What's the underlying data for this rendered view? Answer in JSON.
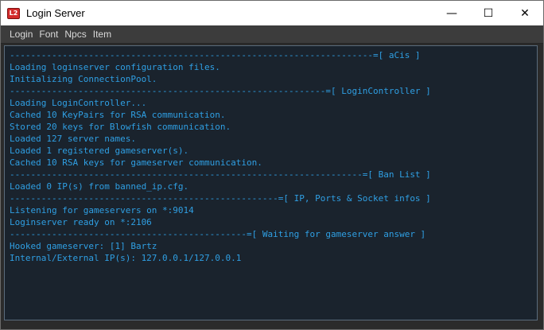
{
  "window": {
    "title": "Login Server",
    "icon_label": "L2",
    "controls": {
      "minimize": "—",
      "maximize": "☐",
      "close": "✕"
    }
  },
  "menu": [
    "Login",
    "Font",
    "Npcs",
    "Item"
  ],
  "console": {
    "lines": [
      "---------------------------------------------------------------------=[ aCis ]",
      "Loading loginserver configuration files.",
      "Initializing ConnectionPool.",
      "------------------------------------------------------------=[ LoginController ]",
      "Loading LoginController...",
      "Cached 10 KeyPairs for RSA communication.",
      "Stored 20 keys for Blowfish communication.",
      "Loaded 127 server names.",
      "Loaded 1 registered gameserver(s).",
      "Cached 10 RSA keys for gameserver communication.",
      "-------------------------------------------------------------------=[ Ban List ]",
      "Loaded 0 IP(s) from banned_ip.cfg.",
      "---------------------------------------------------=[ IP, Ports & Socket infos ]",
      "Listening for gameservers on *:9014",
      "Loginserver ready on *:2106",
      "---------------------------------------------=[ Waiting for gameserver answer ]",
      "Hooked gameserver: [1] Bartz",
      "Internal/External IP(s): 127.0.0.1/127.0.0.1"
    ],
    "text_color": "#2f9fe3",
    "background_color": "#1a232d"
  }
}
